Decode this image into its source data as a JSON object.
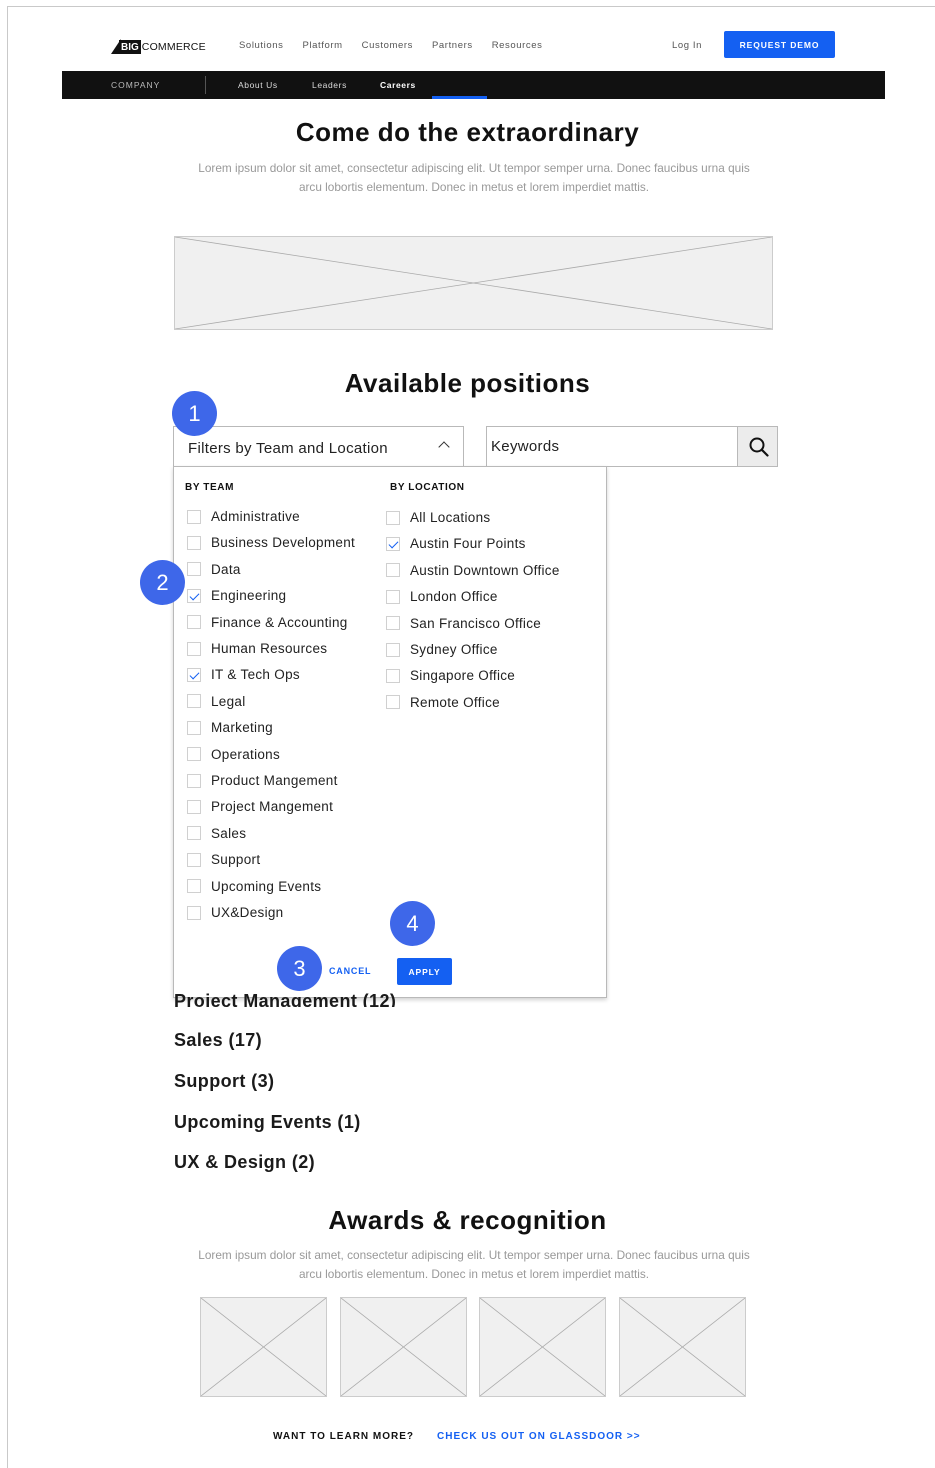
{
  "brand": {
    "logo_big": "BIG",
    "logo_rest": "COMMERCE"
  },
  "top_nav": {
    "items": [
      "Solutions",
      "Platform",
      "Customers",
      "Partners",
      "Resources"
    ],
    "login": "Log In",
    "demo": "REQUEST DEMO"
  },
  "sub_nav": {
    "section": "COMPANY",
    "items": [
      "About Us",
      "Leaders",
      "Careers"
    ],
    "active": "Careers"
  },
  "hero": {
    "title": "Come do the extraordinary",
    "body": "Lorem ipsum dolor sit amet, consectetur adipiscing elit. Ut tempor semper urna. Donec faucibus urna quis arcu lobortis elementum. Donec in metus et lorem imperdiet mattis."
  },
  "positions": {
    "title": "Available positions",
    "filter_label": "Filters by Team and Location",
    "keywords_placeholder": "Keywords",
    "team_heading": "BY TEAM",
    "location_heading": "BY LOCATION",
    "teams": [
      {
        "label": "Administrative",
        "checked": false
      },
      {
        "label": "Business Development",
        "checked": false
      },
      {
        "label": "Data",
        "checked": false
      },
      {
        "label": "Engineering",
        "checked": true
      },
      {
        "label": "Finance & Accounting",
        "checked": false
      },
      {
        "label": "Human Resources",
        "checked": false
      },
      {
        "label": "IT & Tech Ops",
        "checked": true
      },
      {
        "label": "Legal",
        "checked": false
      },
      {
        "label": "Marketing",
        "checked": false
      },
      {
        "label": "Operations",
        "checked": false
      },
      {
        "label": "Product Mangement",
        "checked": false
      },
      {
        "label": "Project Mangement",
        "checked": false
      },
      {
        "label": "Sales",
        "checked": false
      },
      {
        "label": "Support",
        "checked": false
      },
      {
        "label": "Upcoming Events",
        "checked": false
      },
      {
        "label": "UX&Design",
        "checked": false
      }
    ],
    "locations": [
      {
        "label": "All Locations",
        "checked": false
      },
      {
        "label": "Austin Four Points",
        "checked": true
      },
      {
        "label": "Austin Downtown Office",
        "checked": false
      },
      {
        "label": "London Office",
        "checked": false
      },
      {
        "label": "San Francisco Office",
        "checked": false
      },
      {
        "label": "Sydney Office",
        "checked": false
      },
      {
        "label": "Singapore Office",
        "checked": false
      },
      {
        "label": "Remote Office",
        "checked": false
      }
    ],
    "cancel": "CANCEL",
    "apply": "APPLY",
    "annotations": [
      "1",
      "2",
      "3",
      "4"
    ],
    "categories": [
      "Project Management (12)",
      "Sales (17)",
      "Support (3)",
      "Upcoming Events (1)",
      "UX & Design (2)"
    ]
  },
  "awards": {
    "title": "Awards & recognition",
    "body": "Lorem ipsum dolor sit amet, consectetur adipiscing elit. Ut tempor semper urna. Donec faucibus urna quis arcu lobortis elementum. Donec in metus et lorem imperdiet mattis."
  },
  "footer": {
    "question": "WANT TO LEARN MORE?",
    "link": "CHECK US OUT ON GLASSDOOR   >>"
  },
  "colors": {
    "accent": "#1460f2",
    "badge": "#3e67e9",
    "subnav_bg": "#111111"
  }
}
